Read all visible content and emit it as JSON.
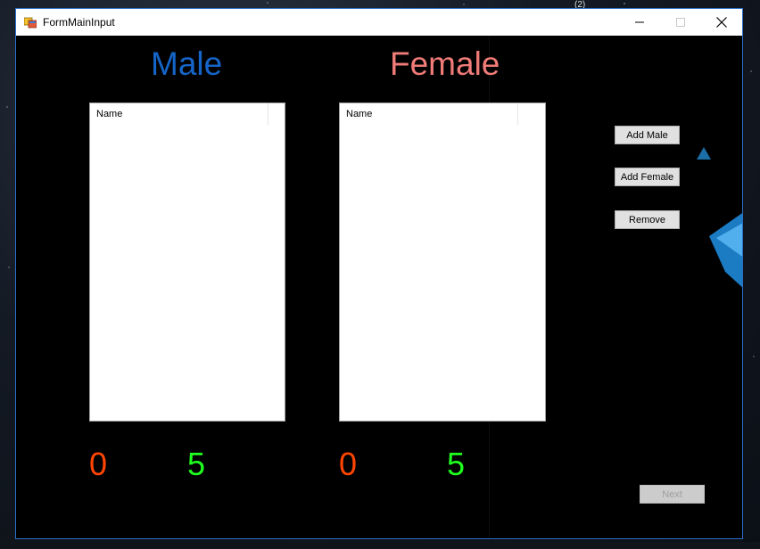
{
  "window": {
    "title": "FormMainInput"
  },
  "desktop": {
    "badge_text": "(2)"
  },
  "labels": {
    "male": "Male",
    "female": "Female"
  },
  "lists": {
    "male": {
      "column_header": "Name",
      "items": []
    },
    "female": {
      "column_header": "Name",
      "items": []
    }
  },
  "counts": {
    "male_current": "0",
    "male_target": "5",
    "female_current": "0",
    "female_target": "5"
  },
  "buttons": {
    "add_male": "Add Male",
    "add_female": "Add Female",
    "remove": "Remove",
    "next": "Next"
  },
  "colors": {
    "male": "#1565c8",
    "female": "#f07b78",
    "current_count": "#ff4500",
    "target_count": "#1fff1f",
    "window_border": "#2b6fc9"
  }
}
